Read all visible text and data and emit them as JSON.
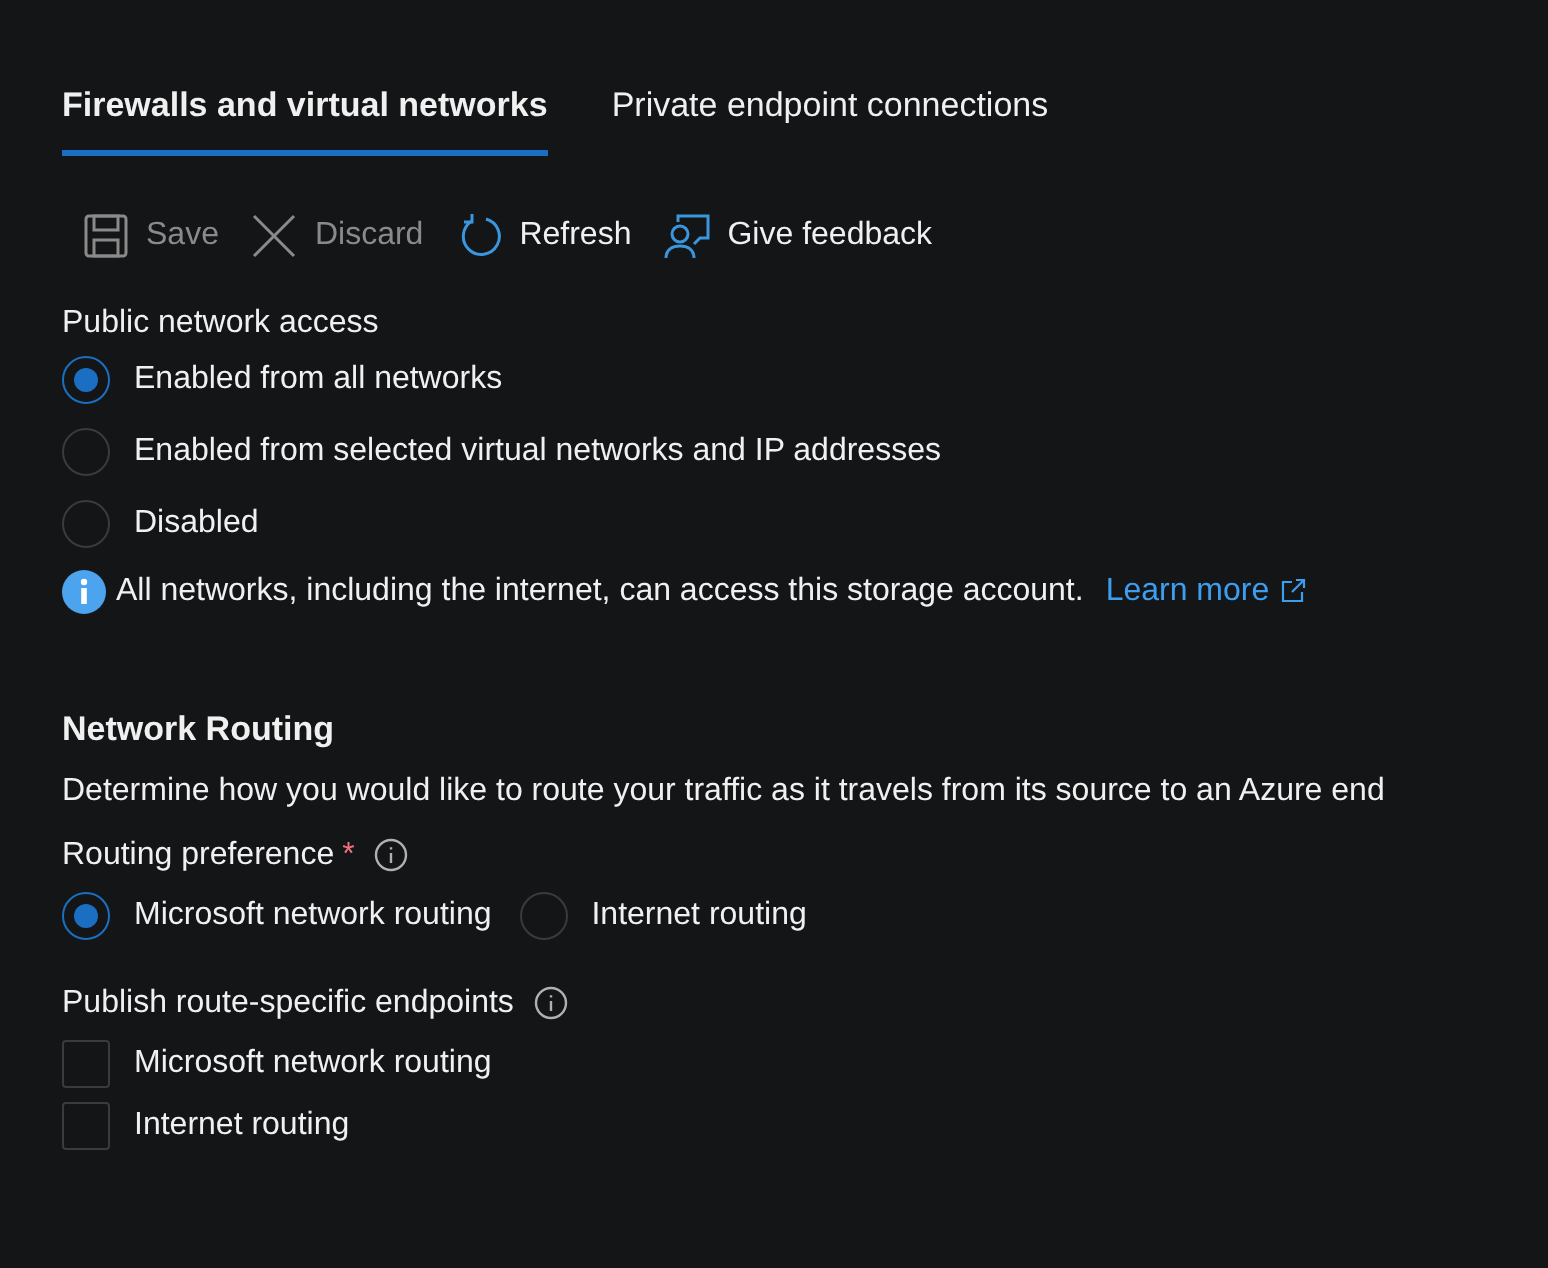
{
  "tabs": [
    {
      "label": "Firewalls and virtual networks",
      "selected": true
    },
    {
      "label": "Private endpoint connections",
      "selected": false
    }
  ],
  "toolbar": [
    {
      "kind": "save",
      "label": "Save",
      "disabled": true
    },
    {
      "kind": "discard",
      "label": "Discard",
      "disabled": true
    },
    {
      "kind": "refresh",
      "label": "Refresh",
      "disabled": false
    },
    {
      "kind": "feedback",
      "label": "Give feedback",
      "disabled": false
    }
  ],
  "public_network_access": {
    "label": "Public network access",
    "options": [
      {
        "label": "Enabled from all networks",
        "selected": true
      },
      {
        "label": "Enabled from selected virtual networks and IP addresses",
        "selected": false
      },
      {
        "label": "Disabled",
        "selected": false
      }
    ],
    "info": {
      "text": "All networks, including the internet, can access this storage account.",
      "link": "Learn more"
    }
  },
  "network_routing": {
    "title": "Network Routing",
    "description": "Determine how you would like to route your traffic as it travels from its source to an Azure end",
    "routing_preference": {
      "label": "Routing preference",
      "required_mark": "*",
      "options": [
        {
          "label": "Microsoft network routing",
          "selected": true
        },
        {
          "label": "Internet routing",
          "selected": false
        }
      ]
    },
    "publish_endpoints": {
      "label": "Publish route-specific endpoints",
      "options": [
        {
          "label": "Microsoft network routing",
          "checked": false
        },
        {
          "label": "Internet routing",
          "checked": false
        }
      ]
    }
  }
}
